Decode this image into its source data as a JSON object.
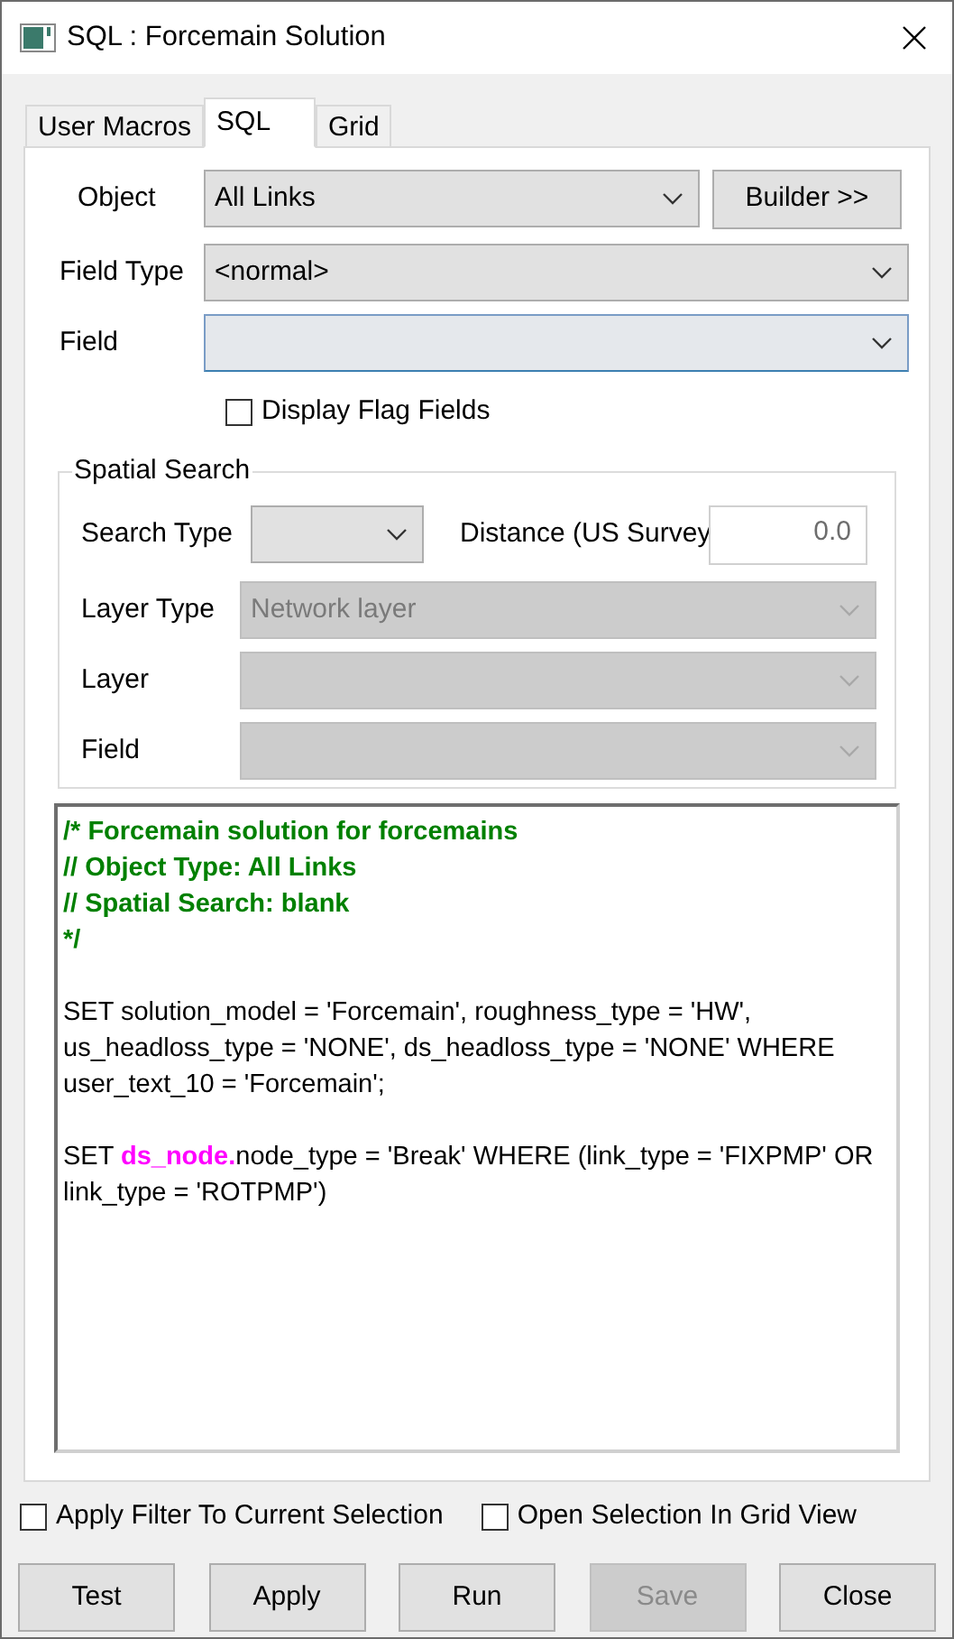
{
  "window": {
    "title": "SQL : Forcemain Solution"
  },
  "tabs": [
    {
      "label": "User Macros",
      "selected": false
    },
    {
      "label": "SQL",
      "selected": true
    },
    {
      "label": "Grid",
      "selected": false
    }
  ],
  "object": {
    "label": "Object",
    "value": "All Links",
    "button": "Builder >>"
  },
  "field_type": {
    "label": "Field Type",
    "value": "<normal>"
  },
  "field": {
    "label": "Field",
    "focused": true
  },
  "display_flag_fields": {
    "label": "Display Flag Fields",
    "checked": false
  },
  "spatial_search": {
    "title": "Spatial Search",
    "search_type": {
      "label": "Search Type"
    },
    "distance": {
      "label": "Distance (US Survey",
      "value": "0.0"
    },
    "rows": [
      {
        "label": "Layer Type",
        "value": "Network layer",
        "disabled": true
      },
      {
        "label": "Layer",
        "disabled": true
      },
      {
        "label": "Field",
        "disabled": true
      }
    ]
  },
  "editor": {
    "lines": [
      {
        "kind": "text",
        "spans": [
          {
            "kind": "comment",
            "text": "/* Forcemain solution for forcemains"
          }
        ]
      },
      {
        "kind": "text",
        "spans": [
          {
            "kind": "comment",
            "text": "// Object Type: All Links"
          }
        ]
      },
      {
        "kind": "text",
        "spans": [
          {
            "kind": "comment",
            "text": "// Spatial Search: blank"
          }
        ]
      },
      {
        "kind": "text",
        "spans": [
          {
            "kind": "comment",
            "text": "*/"
          }
        ]
      },
      {
        "kind": "blank"
      },
      {
        "kind": "text",
        "spans": [
          {
            "kind": "code",
            "text": "SET solution_model = 'Forcemain', roughness_type = 'HW',"
          }
        ]
      },
      {
        "kind": "text",
        "spans": [
          {
            "kind": "code",
            "text": "us_headloss_type = 'NONE', ds_headloss_type = 'NONE' WHERE"
          }
        ]
      },
      {
        "kind": "text",
        "spans": [
          {
            "kind": "code",
            "text": "user_text_10 = 'Forcemain';"
          }
        ]
      },
      {
        "kind": "blank"
      },
      {
        "kind": "text",
        "spans": [
          {
            "kind": "code",
            "text": "SET "
          },
          {
            "kind": "table",
            "text": "ds_node."
          },
          {
            "kind": "code",
            "text": "node_type = 'Break' WHERE (link_type = 'FIXPMP' OR"
          }
        ]
      },
      {
        "kind": "text",
        "spans": [
          {
            "kind": "code",
            "text": "link_type = 'ROTPMP')"
          }
        ]
      }
    ]
  },
  "options": [
    {
      "label": "Apply Filter To Current Selection",
      "checked": false
    },
    {
      "label": "Open Selection In Grid View",
      "checked": false
    }
  ],
  "buttons": [
    {
      "label": "Test",
      "disabled": false
    },
    {
      "label": "Apply",
      "disabled": false
    },
    {
      "label": "Run",
      "disabled": false
    },
    {
      "label": "Save",
      "disabled": true
    },
    {
      "label": "Close",
      "disabled": false
    }
  ]
}
